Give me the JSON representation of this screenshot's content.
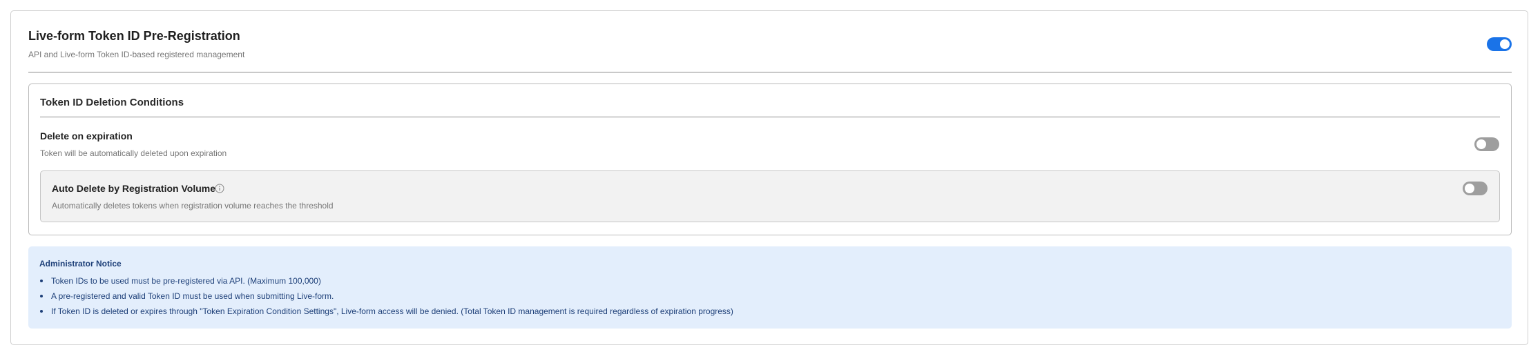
{
  "header": {
    "title": "Live-form Token ID Pre-Registration",
    "subtitle": "API and Live-form Token ID-based registered management",
    "toggle_state": "on"
  },
  "deletion_conditions": {
    "title": "Token ID Deletion Conditions",
    "expiration": {
      "label": "Delete on expiration",
      "description": "Token will be automatically deleted upon expiration",
      "toggle_state": "off"
    },
    "volume": {
      "label": "Auto Delete by Registration Volume",
      "description": "Automatically deletes tokens when registration volume reaches the threshold",
      "info_icon": "info-icon",
      "toggle_state": "off"
    }
  },
  "notice": {
    "title": "Administrator Notice",
    "items": [
      "Token IDs to be used must be pre-registered via API. (Maximum 100,000)",
      "A pre-registered and valid Token ID must be used when submitting Live-form.",
      "If Token ID is deleted or expires through \"Token Expiration Condition Settings\", Live-form access will be denied. (Total Token ID management is required regardless of expiration progress)"
    ]
  },
  "colors": {
    "accent": "#1a73e8",
    "toggle_off": "#9e9e9e",
    "notice_bg": "#e3eefc",
    "notice_text": "#1d3f78"
  }
}
